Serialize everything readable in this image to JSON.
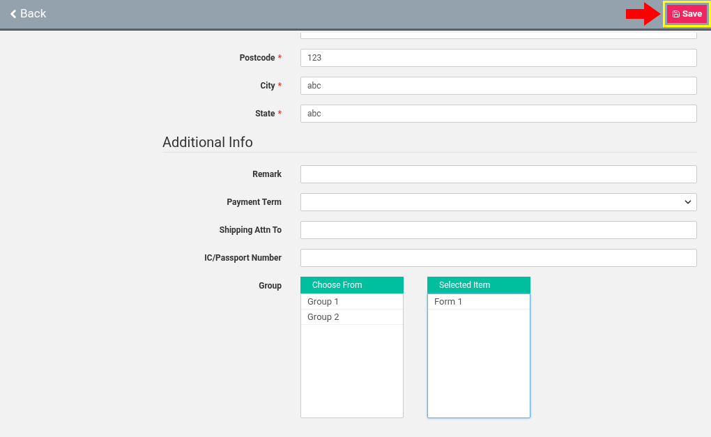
{
  "top_bar": {
    "back": "Back",
    "save": "Save"
  },
  "shipping_info": {
    "fields": [
      {
        "kind": "text",
        "label": "Postcode",
        "marker": "*",
        "value": "123"
      },
      {
        "kind": "text",
        "label": "City",
        "marker": "*",
        "value": "abc"
      },
      {
        "kind": "text",
        "label": "State",
        "marker": "*",
        "value": "abc"
      }
    ]
  },
  "additional_info": {
    "heading": "Additional Info",
    "fields": [
      {
        "kind": "text",
        "label": "Remark"
      },
      {
        "kind": "select",
        "label": "Payment Term"
      },
      {
        "kind": "text",
        "label": "Shipping Attn To"
      },
      {
        "kind": "text",
        "label": "IC/Passport Number"
      },
      {
        "kind": "group",
        "label": "Group",
        "choose_from": {
          "title": "Choose From",
          "items": [
            "Group 1",
            "Group 2"
          ]
        },
        "selected_items": {
          "title": "Selected Item",
          "items": [
            "Form 1"
          ]
        }
      }
    ]
  }
}
